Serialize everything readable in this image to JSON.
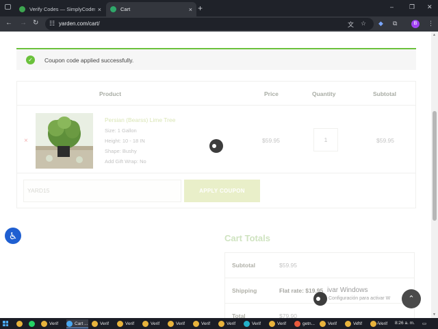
{
  "browser": {
    "tabs": [
      {
        "title": "Verify Codes — SimplyCodes",
        "close": "×"
      },
      {
        "title": "Cart",
        "close": "×"
      }
    ],
    "new_tab": "+",
    "window_controls": [
      "⌄",
      "–",
      "❐",
      "✕"
    ],
    "url": "yarden.com/cart/",
    "profile_initial": "B"
  },
  "notice": {
    "message": "Coupon code applied successfully.",
    "check_icon": "✓",
    "accent_color": "#6ac13b"
  },
  "cart": {
    "headers": {
      "product": "Product",
      "price": "Price",
      "quantity": "Quantity",
      "subtotal": "Subtotal"
    },
    "item": {
      "remove": "×",
      "name": "Persian (Bearss) Lime Tree",
      "attributes": [
        "Size: 1 Gallon",
        "Height: 10 - 18 IN",
        "Shape: Bushy",
        "Add Gift Wrap: No"
      ],
      "price": "$59.95",
      "quantity": "1",
      "subtotal": "$59.95"
    },
    "coupon": {
      "value": "YARD15",
      "button": "APPLY COUPON"
    }
  },
  "totals": {
    "title": "Cart Totals",
    "rows": [
      {
        "label": "Subtotal",
        "value": "$59.95"
      },
      {
        "label": "Shipping",
        "value": "Flat rate: $19.95"
      },
      {
        "label": "Total",
        "value": "$79.90"
      }
    ]
  },
  "overlay": {
    "watermark_title": "ivar Windows",
    "watermark_sub": "Configuración para activar W"
  },
  "taskbar": {
    "apps": [
      "Verif",
      "Cart ...",
      "Verif",
      "Verif",
      "Verif",
      "Verif",
      "Verif",
      "Verif",
      "Verif",
      "Verif",
      "getn...",
      "Verif",
      "Verif",
      "Verif"
    ],
    "clock": "8:26 a. m."
  }
}
